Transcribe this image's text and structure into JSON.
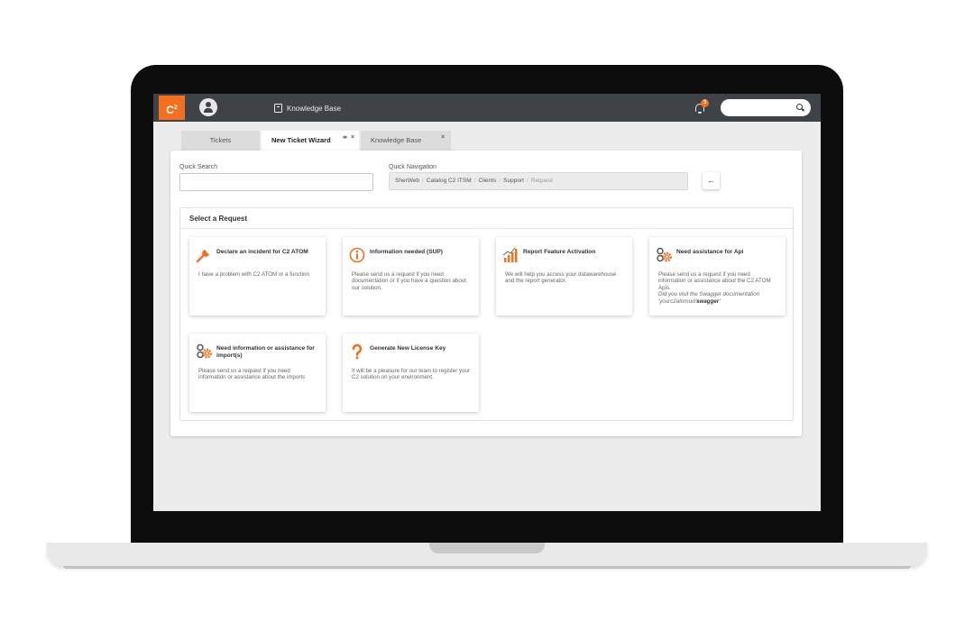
{
  "header": {
    "logo_text": "C",
    "logo_sup": "2",
    "kb_link_label": "Knowledge Base",
    "notification_count": "3",
    "search_placeholder": ""
  },
  "tabs": [
    {
      "label": "Tickets"
    },
    {
      "label": "New Ticket Wizard",
      "pin": "⇹",
      "close": "×"
    },
    {
      "label": "Knowledge Base",
      "close": "×"
    }
  ],
  "search": {
    "label": "Quick Search",
    "value": ""
  },
  "navigation": {
    "label": "Quick Navigation",
    "crumbs": [
      "SherWeb",
      "Catalog C2 ITSM",
      "Clients",
      "Support",
      "Request"
    ],
    "separator": "/",
    "back_label": "←"
  },
  "requests": {
    "title": "Select a Request",
    "cards": [
      {
        "icon": "wrench-icon",
        "title": "Declare an incident for C2 ATOM",
        "desc": "I have a problem with C2 ATOM or a function"
      },
      {
        "icon": "info-icon",
        "title": "Information needed (SUP)",
        "desc": "Please send us a request if you need documentation or if you have a question about our solution."
      },
      {
        "icon": "bar-chart-icon",
        "title": "Report Feature Activation",
        "desc": "We will help you access your datawarehouse and the report generator."
      },
      {
        "icon": "gears-icon",
        "title": "Need assistance for Api",
        "desc": "Please send us a request if you need information or assistance about the C2 ATOM Apis.",
        "note": "Did you visit the Swagger documentation 'yourc2atomurl/",
        "note_bold": "swagger",
        "note_end": "'"
      },
      {
        "icon": "gears-icon",
        "title": "Need information or assistance for import(s)",
        "desc": "Please send us a request if you need information or assistance about the imports"
      },
      {
        "icon": "question-icon",
        "title": "Generate New License Key",
        "desc": "It will be a pleasure for our team to register your C2 solution on your environment."
      }
    ]
  },
  "colors": {
    "accent": "#f37021",
    "topbar": "#3f4348",
    "background": "#ececec"
  }
}
